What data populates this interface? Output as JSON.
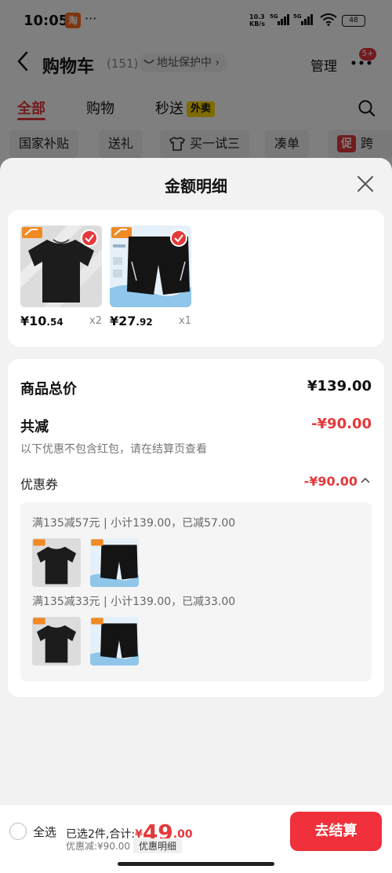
{
  "status_bar": {
    "time": "10:05",
    "app_icon_text": "淘",
    "dots": "···",
    "net_speed": "10.3",
    "net_unit": "KB/s",
    "battery": "48"
  },
  "nav": {
    "title": "购物车",
    "count": "(151)",
    "address_pill": "地址保护中 ›",
    "manage": "管理",
    "badge": "5+"
  },
  "tabs": {
    "all": "全部",
    "shop": "购物",
    "miaosong": "秒送",
    "waimai": "外卖"
  },
  "chips": [
    "国家补贴",
    "送礼",
    "买一试三",
    "凑单",
    "跨"
  ],
  "chip_promo_tag": "促",
  "sheet": {
    "title": "金额明细",
    "products": [
      {
        "price_int": "¥10",
        "price_dec": ".54",
        "qty": "x2"
      },
      {
        "price_int": "¥27",
        "price_dec": ".92",
        "qty": "x1"
      }
    ],
    "total_label": "商品总价",
    "total_value": "¥139.00",
    "reduce_label": "共减",
    "reduce_value": "-¥90.00",
    "note": "以下优惠不包含红包，请在结算页查看",
    "coupon_label": "优惠券",
    "coupon_value": "-¥90.00",
    "coupon_lines": [
      "满135减57元 | 小计139.00，已减57.00",
      "满135减33元 | 小计139.00，已减33.00"
    ]
  },
  "bottom_bar": {
    "select_all": "全选",
    "selected_text": "已选2件,合计:",
    "total_symbol": "¥",
    "total_int": "49",
    "total_dec": ".00",
    "discount_text": "优惠减:¥90.00",
    "detail_label": "优惠明细",
    "checkout": "去结算"
  },
  "colors": {
    "accent": "#e4393c",
    "checkout_bg": "#f0303a",
    "sheet_bg": "#f2f2f2"
  }
}
